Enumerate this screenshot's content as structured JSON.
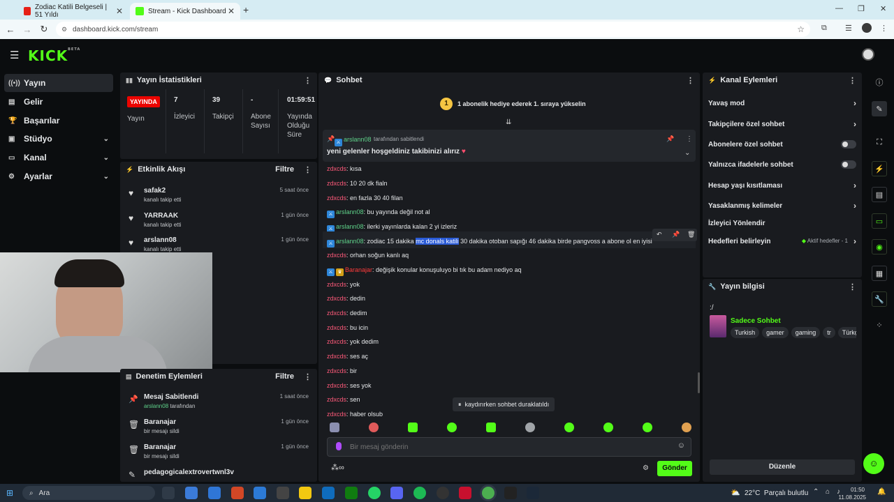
{
  "browser": {
    "tabs": [
      {
        "title": "Zodiac Katili Belgeseli | 51 Yıldı",
        "favicon_color": "#e62117"
      },
      {
        "title": "Stream - Kick Dashboard",
        "favicon_color": "#53fc18"
      }
    ],
    "url": "dashboard.kick.com/stream"
  },
  "kick": {
    "logo": "KICK",
    "beta": "BETA"
  },
  "sidebar": {
    "items": [
      {
        "label": "Yayın",
        "icon": "broadcast-icon",
        "active": true
      },
      {
        "label": "Gelir",
        "icon": "money-icon"
      },
      {
        "label": "Başarılar",
        "icon": "trophy-icon"
      },
      {
        "label": "Stüdyo",
        "icon": "studio-icon",
        "chevron": true
      },
      {
        "label": "Kanal",
        "icon": "channel-icon",
        "chevron": true
      },
      {
        "label": "Ayarlar",
        "icon": "gear-icon",
        "chevron": true
      }
    ]
  },
  "stats": {
    "title": "Yayın İstatistikleri",
    "live_badge": "YAYINDA",
    "live_label": "Yayın",
    "viewers_value": "7",
    "viewers_label": "İzleyici",
    "followers_value": "39",
    "followers_label": "Takipçi",
    "subs_value": "-",
    "subs_label1": "Abone",
    "subs_label2": "Sayısı",
    "uptime_value": "01:59:51",
    "uptime_label1": "Yayında",
    "uptime_label2": "Olduğu",
    "uptime_label3": "Süre"
  },
  "activity": {
    "title": "Etkinlik Akışı",
    "filter": "Filtre",
    "items": [
      {
        "name": "safak2",
        "sub": "kanalı takip etti",
        "time": "5 saat önce"
      },
      {
        "name": "YARRAAK",
        "sub": "kanalı takip etti",
        "time": "1 gün önce"
      },
      {
        "name": "arslann08",
        "sub": "kanalı takip etti",
        "time": "1 gün önce"
      }
    ]
  },
  "moderation": {
    "title": "Denetim Eylemleri",
    "filter": "Filtre",
    "items": [
      {
        "name": "Mesaj Sabitlendi",
        "sub_user": "arslann08",
        "sub": " tarafından",
        "time": "1 saat önce",
        "icon": "pin-icon"
      },
      {
        "name": "Baranajar",
        "sub": "bir mesajı sildi",
        "time": "1 gün önce",
        "icon": "trash-icon"
      },
      {
        "name": "Baranajar",
        "sub": "bir mesajı sildi",
        "time": "1 gün önce",
        "icon": "trash-icon"
      },
      {
        "name": "pedagogicalextrovertwnl3v",
        "sub": "",
        "time": "",
        "icon": "edit-icon"
      }
    ]
  },
  "chat": {
    "title": "Sohbet",
    "goal_text": "1 abonelik hediye ederek 1. sıraya yükselin",
    "goal_rank": "1",
    "pinned_by_user": "arslann08",
    "pinned_by_suffix": "tarafından sabitlendi",
    "pinned_message": "yeni gelenler hoşgeldiniz takibinizi alırız",
    "messages": [
      {
        "user": "zdxcds",
        "text": ": kısa",
        "color": "red"
      },
      {
        "user": "zdxcds",
        "text": ": 10 20 dk fialn",
        "color": "red"
      },
      {
        "user": "zdxcds",
        "text": ": en fazla 30 40 filan",
        "color": "red"
      },
      {
        "user": "arslann08",
        "text": ": bu yayında değil not al",
        "color": "green",
        "badge": true
      },
      {
        "user": "arslann08",
        "text": ": ilerki yayınlarda kalan 2 yi izleriz",
        "color": "green",
        "badge": true
      },
      {
        "user": "arslann08",
        "text_pre": ": zodiac 15 dakika ",
        "text_hl": "mc donals katili",
        "text_post": " 30 dakika otoban sapığı 46 dakika birde pangvoss a abone ol en iyisi",
        "color": "green",
        "badge": true
      },
      {
        "user": "zdxcds",
        "text": ": orhan soğun kanlı aq",
        "color": "red"
      },
      {
        "user": "Baranajar",
        "text": ": değişik konular konuşuluyo bi tık bu adam nediyo aq",
        "color": "red",
        "badge": true
      },
      {
        "user": "zdxcds",
        "text": ": yok",
        "color": "red"
      },
      {
        "user": "zdxcds",
        "text": ": dedin",
        "color": "red"
      },
      {
        "user": "zdxcds",
        "text": ": dedim",
        "color": "red"
      },
      {
        "user": "zdxcds",
        "text": ": bu icin",
        "color": "red"
      },
      {
        "user": "zdxcds",
        "text": ": yok dedim",
        "color": "red"
      },
      {
        "user": "zdxcds",
        "text": ": ses aç",
        "color": "red"
      },
      {
        "user": "zdxcds",
        "text": ": bir",
        "color": "red"
      },
      {
        "user": "zdxcds",
        "text": ": ses yok",
        "color": "red"
      },
      {
        "user": "zdxcds",
        "text": ": sen",
        "color": "red"
      },
      {
        "user": "zdxcds",
        "text": ": haber olsub",
        "color": "red"
      }
    ],
    "paused_text": "kaydırırken sohbet duraklatıldı",
    "input_placeholder": "Bir mesaj gönderin",
    "send_label": "Gönder"
  },
  "channel_actions": {
    "title": "Kanal Eylemleri",
    "slow_mode": "Yavaş mod",
    "followers_only": "Takipçilere özel sohbet",
    "subs_only": "Abonelere özel sohbet",
    "emotes_only": "Yalnızca ifadelerle sohbet",
    "account_age": "Hesap yaşı kısıtlaması",
    "banned_words": "Yasaklanmış kelimeler",
    "redirect": "İzleyici Yönlendir",
    "goals": "Hedefleri belirleyin",
    "goals_status": "Aktif hedefler - 1"
  },
  "stream_info": {
    "title": "Yayın bilgisi",
    "stream_title": ":/",
    "category": "Sadece Sohbet",
    "tags": [
      "Turkish",
      "gamer",
      "gaming",
      "tr",
      "Türkç"
    ],
    "edit_label": "Düzenle"
  },
  "taskbar": {
    "search": "Ara",
    "weather": "22°C  Parçalı bulutlu",
    "time": "01:50",
    "date": "11.08.2025"
  },
  "colors": {
    "accent": "#53fc18",
    "live": "#eb0400",
    "panel": "#191b1f"
  }
}
